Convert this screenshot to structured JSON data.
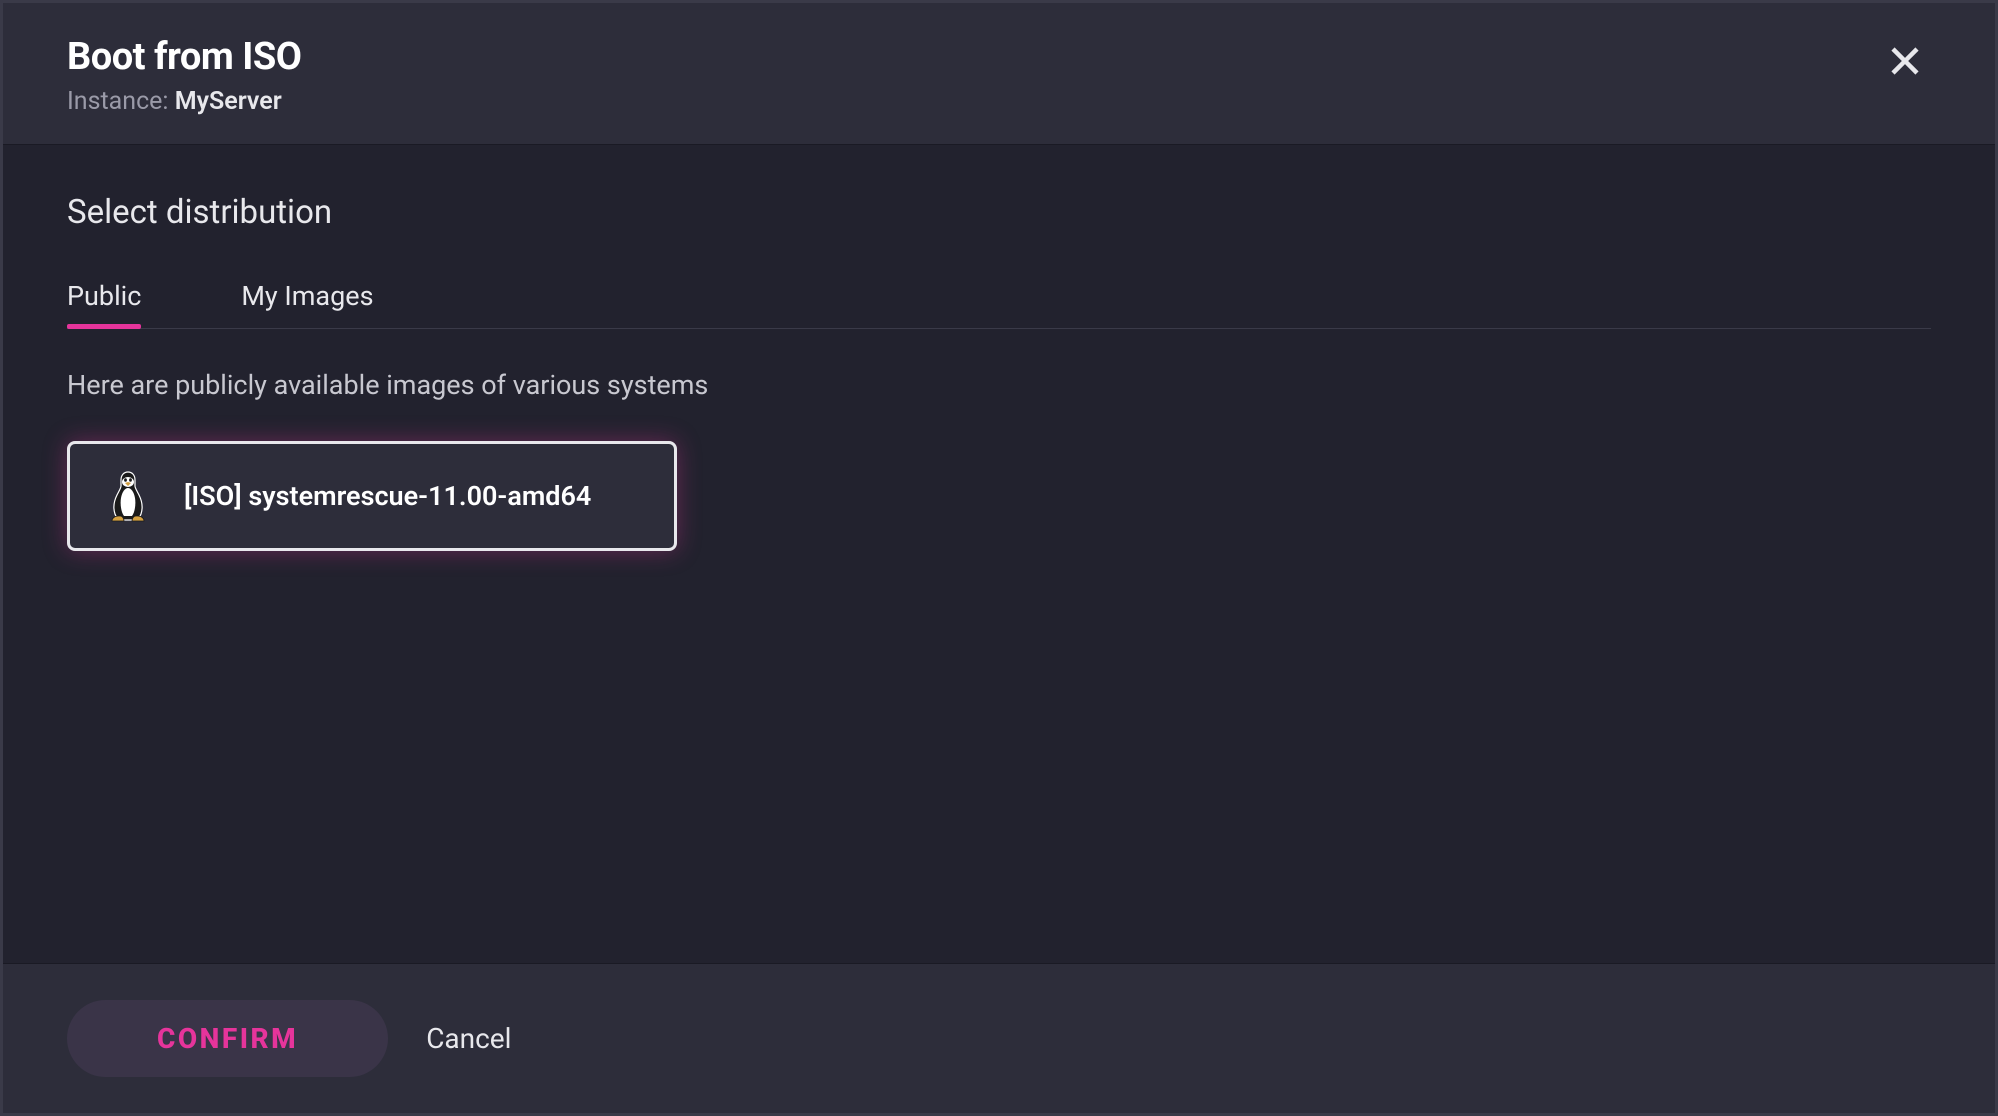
{
  "header": {
    "title": "Boot from ISO",
    "subtitle_prefix": "Instance: ",
    "instance_name": "MyServer"
  },
  "body": {
    "section_heading": "Select distribution",
    "tabs": [
      {
        "label": "Public",
        "active": true
      },
      {
        "label": "My Images",
        "active": false
      }
    ],
    "tab_description": "Here are publicly available images of various systems",
    "images": [
      {
        "icon": "linux-tux",
        "label": "[ISO] systemrescue-11.00-amd64",
        "selected": true
      }
    ]
  },
  "footer": {
    "confirm_label": "CONFIRM",
    "cancel_label": "Cancel"
  },
  "colors": {
    "accent": "#e6349b",
    "bg_dark": "#22222e",
    "bg_panel": "#2d2d3a"
  }
}
